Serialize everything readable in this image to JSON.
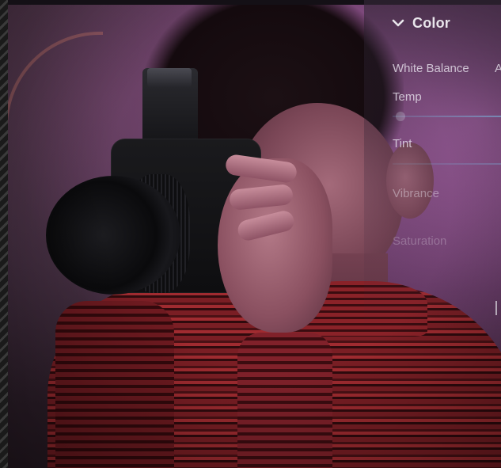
{
  "panel": {
    "section_title": "Color",
    "white_balance": {
      "label": "White Balance",
      "value": "A"
    },
    "sliders": [
      {
        "label": "Temp"
      },
      {
        "label": "Tint"
      },
      {
        "label": "Vibrance"
      },
      {
        "label": "Saturation"
      }
    ]
  },
  "icons": {
    "chevron": "chevron-down-icon"
  },
  "colors": {
    "panel_text": "#e9e6ec",
    "slider_track": "#78bee6",
    "sweater_red": "#7a1e24",
    "background_purple": "#cd78cd"
  }
}
